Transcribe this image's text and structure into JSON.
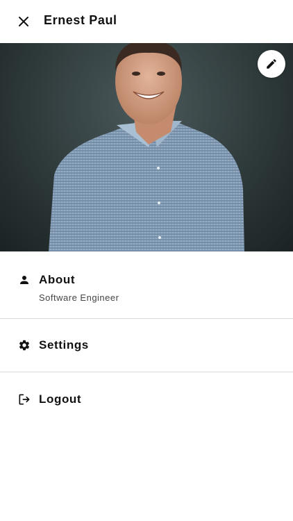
{
  "header": {
    "title": "Ernest Paul"
  },
  "profile": {
    "photo_description_icon": "profile-photo",
    "edit_icon": "pencil-icon"
  },
  "menu": {
    "about": {
      "label": "About",
      "subtitle": "Software Engineer",
      "icon": "person-icon"
    },
    "settings": {
      "label": "Settings",
      "icon": "gear-icon"
    },
    "logout": {
      "label": "Logout",
      "icon": "logout-icon"
    }
  },
  "colors": {
    "background": "#ffffff",
    "text": "#111111",
    "divider": "#d9d9d9",
    "photo_bg": "#3a4748"
  }
}
